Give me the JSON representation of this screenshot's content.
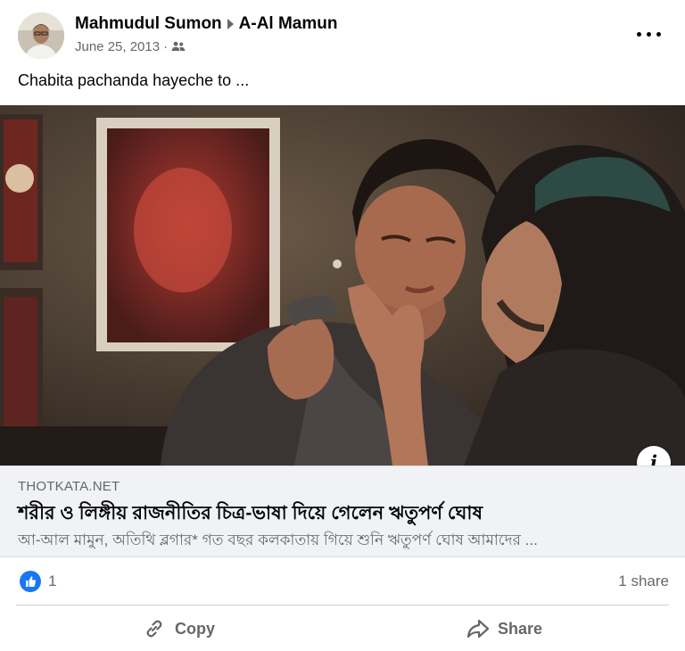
{
  "post": {
    "author": "Mahmudul Sumon",
    "target": "A-Al Mamun",
    "date": "June 25, 2013",
    "dot": "·",
    "audience_icon": "friends-icon",
    "text": "Chabita pachanda hayeche to ..."
  },
  "link": {
    "domain": "THOTKATA.NET",
    "title": "শরীর ও লিঙ্গীয় রাজনীতির চিত্র-ভাষা দিয়ে গেলেন ঋতুপর্ণ ঘোষ",
    "description": "আ-আল মামুন, অতিথি ব্লগার* গত বছর কলকাতায় গিয়ে শুনি ঋতুপর্ণ ঘোষ আমাদের ..."
  },
  "stats": {
    "likes": "1",
    "shares": "1 share"
  },
  "actions": {
    "copy_label": "Copy",
    "share_label": "Share"
  },
  "colors": {
    "accent": "#1877f2",
    "secondary_text": "#65676b",
    "link_box_bg": "#f0f2f5"
  },
  "icons": {
    "more": "more-horizontal-icon",
    "info": "info-icon",
    "like": "like-icon",
    "copy": "link-icon",
    "share": "share-arrow-icon"
  }
}
